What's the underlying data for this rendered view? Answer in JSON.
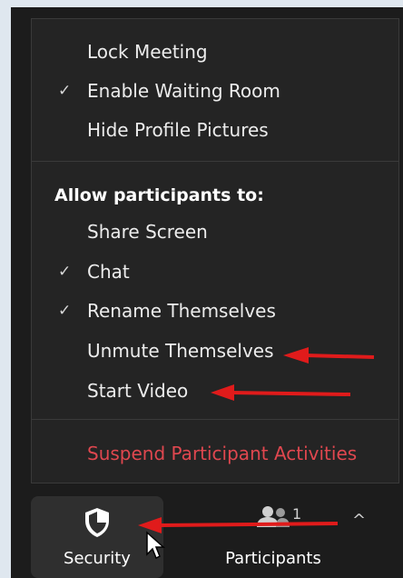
{
  "menu": {
    "items": [
      {
        "label": "Lock Meeting",
        "checked": false
      },
      {
        "label": "Enable Waiting Room",
        "checked": true
      },
      {
        "label": "Hide Profile Pictures",
        "checked": false
      }
    ],
    "section_header": "Allow participants to:",
    "permissions": [
      {
        "label": "Share Screen",
        "checked": false
      },
      {
        "label": "Chat",
        "checked": true
      },
      {
        "label": "Rename Themselves",
        "checked": true
      },
      {
        "label": "Unmute Themselves",
        "checked": false
      },
      {
        "label": "Start Video",
        "checked": false
      }
    ],
    "danger_item": "Suspend Participant Activities",
    "check_glyph": "✓"
  },
  "toolbar": {
    "security_label": "Security",
    "participants_label": "Participants",
    "participants_count": "1",
    "caret": "^"
  },
  "colors": {
    "menu_bg": "#242424",
    "text": "#ececec",
    "danger": "#e0474f",
    "annotation_arrow": "#e01b1b"
  },
  "icons": [
    "checkmark-icon",
    "shield-icon",
    "participants-icon",
    "caret-up-icon",
    "mouse-cursor-icon",
    "red-arrow-annotation"
  ]
}
